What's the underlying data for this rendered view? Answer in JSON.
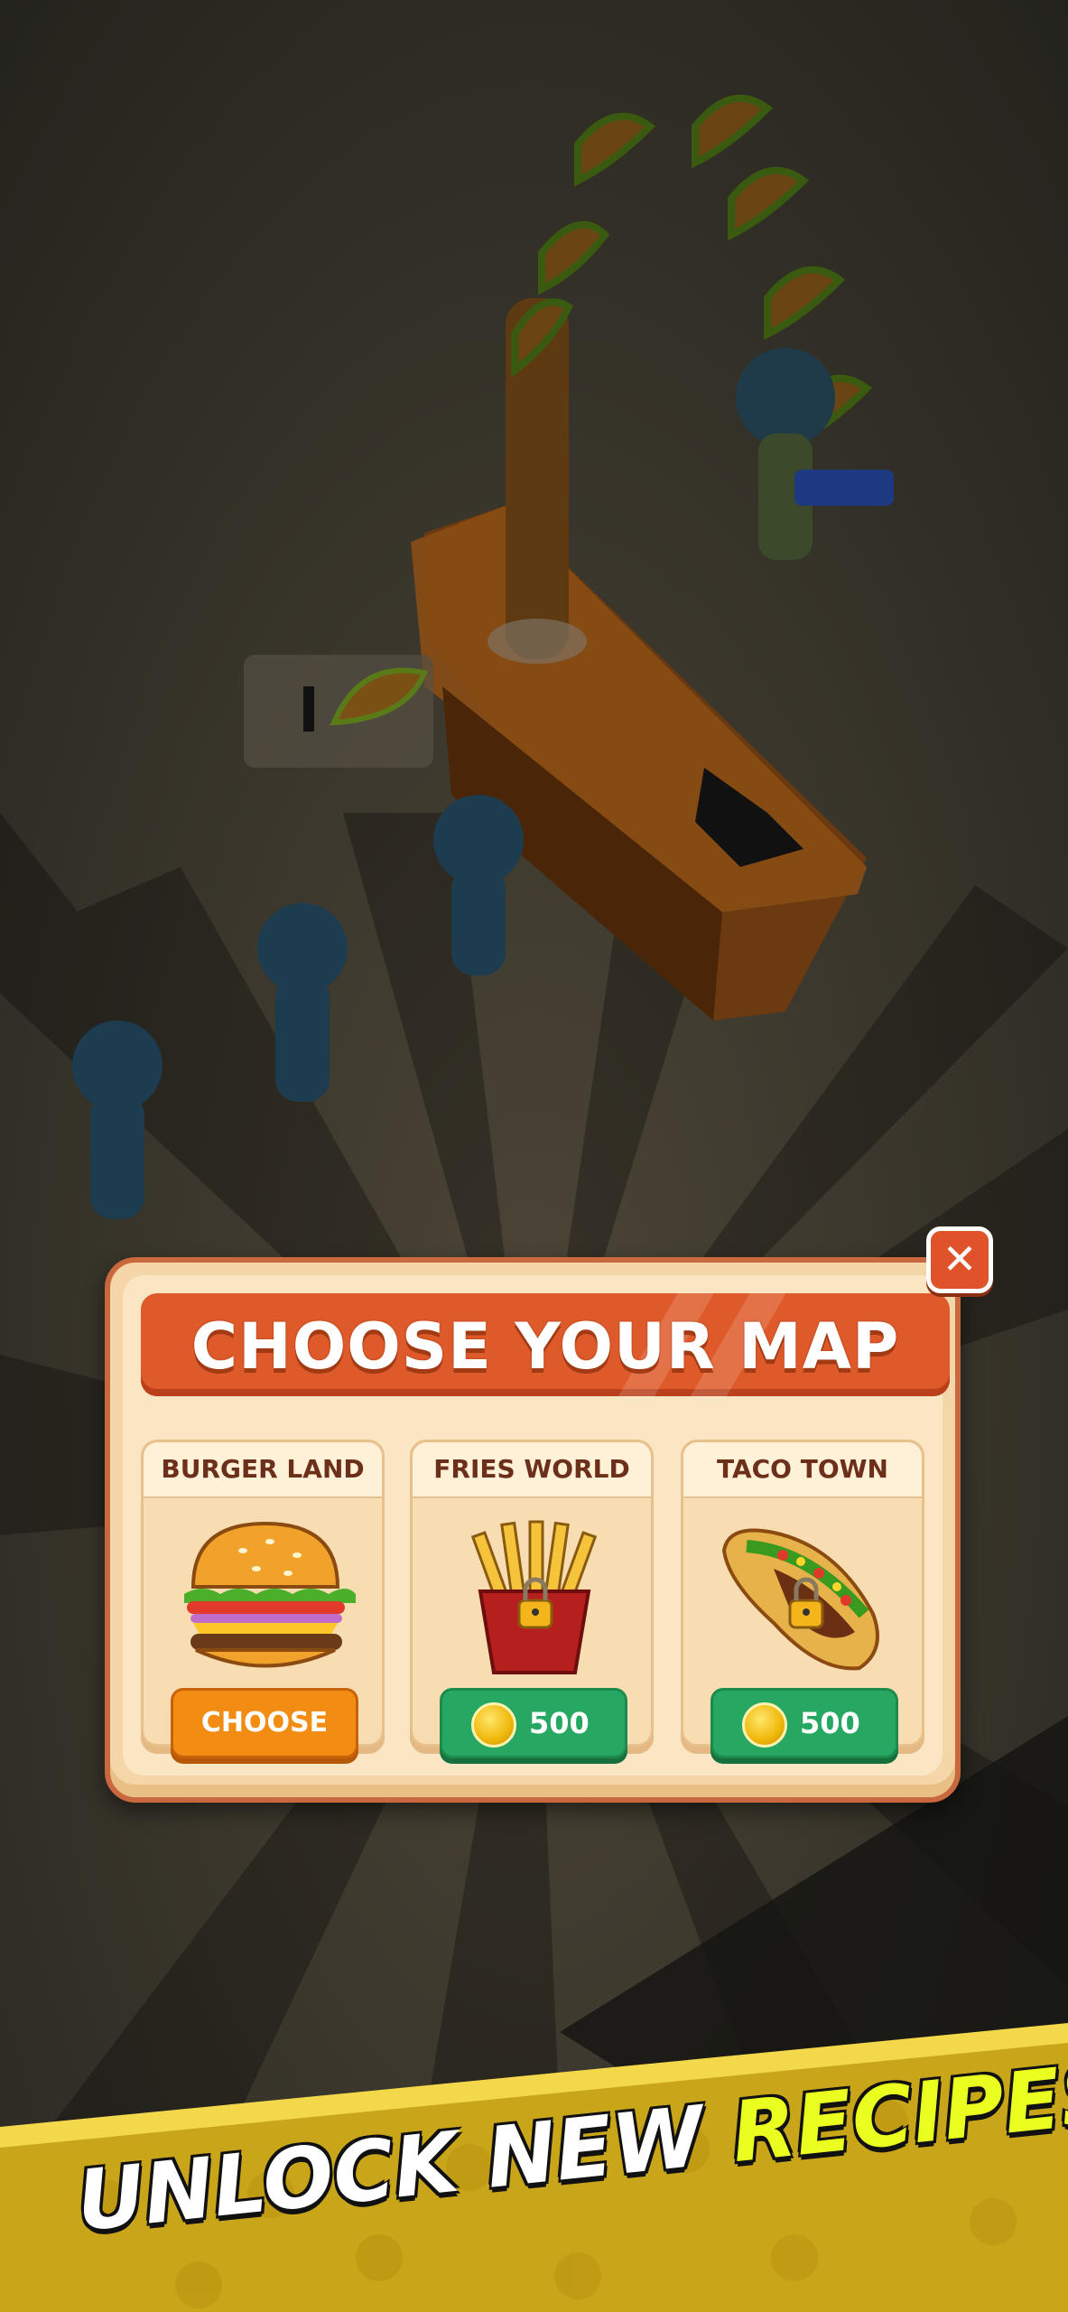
{
  "popup": {
    "title": "CHOOSE YOUR MAP",
    "close_icon": "close-icon",
    "maps": [
      {
        "name": "BURGER LAND",
        "image_icon": "burger-icon",
        "locked": false,
        "button_label": "CHOOSE"
      },
      {
        "name": "FRIES WORLD",
        "image_icon": "fries-icon",
        "locked": true,
        "price": "500",
        "currency_icon": "coin-icon"
      },
      {
        "name": "TACO TOWN",
        "image_icon": "taco-icon",
        "locked": true,
        "price": "500",
        "currency_icon": "coin-icon"
      }
    ]
  },
  "banner": {
    "text_part1": "UNLOCK NEW",
    "text_part2": "RECIPES"
  },
  "colors": {
    "title_banner": "#de5a2a",
    "choose_button": "#f28c12",
    "price_button": "#27a862",
    "banner_highlight": "#eaff1f"
  }
}
